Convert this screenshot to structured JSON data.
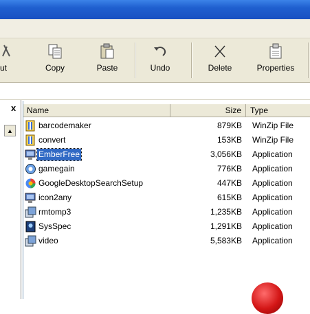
{
  "toolbar": {
    "partial_label": "ut",
    "buttons": [
      {
        "label": "Copy",
        "icon": "copy-icon"
      },
      {
        "label": "Paste",
        "icon": "paste-icon"
      },
      {
        "label": "Undo",
        "icon": "undo-icon"
      },
      {
        "label": "Delete",
        "icon": "delete-icon"
      },
      {
        "label": "Properties",
        "icon": "properties-icon"
      }
    ]
  },
  "folder_pane": {
    "close_glyph": "x",
    "scroll_up_glyph": "▲"
  },
  "file_list": {
    "columns": {
      "name": "Name",
      "size": "Size",
      "type": "Type"
    },
    "rows": [
      {
        "name": "barcodemaker",
        "size": "879KB",
        "type": "WinZip File",
        "icon": "winzip-icon",
        "selected": false
      },
      {
        "name": "convert",
        "size": "153KB",
        "type": "WinZip File",
        "icon": "winzip-icon",
        "selected": false
      },
      {
        "name": "EmberFree",
        "size": "3,056KB",
        "type": "Application",
        "icon": "installer-icon",
        "selected": true
      },
      {
        "name": "gamegain",
        "size": "776KB",
        "type": "Application",
        "icon": "application-icon",
        "selected": false
      },
      {
        "name": "GoogleDesktopSearchSetup",
        "size": "447KB",
        "type": "Application",
        "icon": "google-icon",
        "selected": false
      },
      {
        "name": "icon2any",
        "size": "615KB",
        "type": "Application",
        "icon": "installer-icon",
        "selected": false
      },
      {
        "name": "rmtomp3",
        "size": "1,235KB",
        "type": "Application",
        "icon": "setup-icon",
        "selected": false
      },
      {
        "name": "SysSpec",
        "size": "1,291KB",
        "type": "Application",
        "icon": "sysspec-icon",
        "selected": false
      },
      {
        "name": "video",
        "size": "5,583KB",
        "type": "Application",
        "icon": "setup-icon",
        "selected": false
      }
    ]
  },
  "colors": {
    "selection": "#316ac5",
    "toolbar_bg": "#ece9d8",
    "titlebar": "#1f5fcf"
  }
}
